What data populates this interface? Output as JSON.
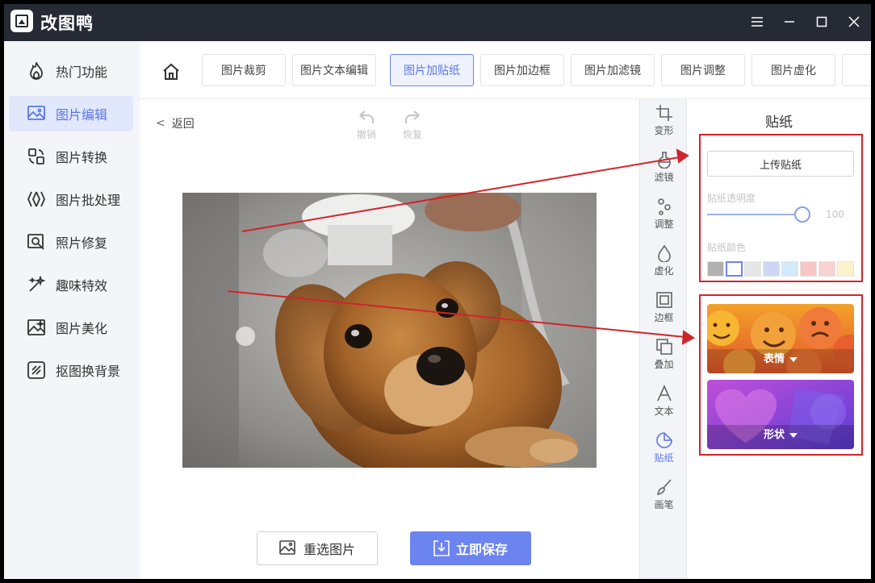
{
  "app": {
    "title": "改图鸭"
  },
  "sidebar": {
    "items": [
      {
        "label": "热门功能",
        "icon": "fire-icon"
      },
      {
        "label": "图片编辑",
        "icon": "image-edit-icon"
      },
      {
        "label": "图片转换",
        "icon": "convert-icon"
      },
      {
        "label": "图片批处理",
        "icon": "batch-icon"
      },
      {
        "label": "照片修复",
        "icon": "photo-repair-icon"
      },
      {
        "label": "趣味特效",
        "icon": "magic-wand-icon"
      },
      {
        "label": "图片美化",
        "icon": "beautify-icon"
      },
      {
        "label": "抠图换背景",
        "icon": "cutout-icon"
      }
    ],
    "active_index": 1
  },
  "tabs": {
    "items": [
      "图片裁剪",
      "图片文本编辑",
      "图片加贴纸",
      "图片加边框",
      "图片加滤镜",
      "图片调整",
      "图片虚化"
    ],
    "active_index": 2
  },
  "canvas": {
    "back_label": "返回",
    "undo_label": "撤销",
    "redo_label": "恢复",
    "reselect_label": "重选图片",
    "save_label": "立即保存"
  },
  "tools": {
    "items": [
      {
        "label": "变形",
        "icon": "transform-icon"
      },
      {
        "label": "滤镜",
        "icon": "filter-icon"
      },
      {
        "label": "调整",
        "icon": "adjust-icon"
      },
      {
        "label": "虚化",
        "icon": "blur-drop-icon"
      },
      {
        "label": "边框",
        "icon": "frame-icon"
      },
      {
        "label": "叠加",
        "icon": "overlay-icon"
      },
      {
        "label": "文本",
        "icon": "text-icon"
      },
      {
        "label": "贴纸",
        "icon": "sticker-icon"
      },
      {
        "label": "画笔",
        "icon": "brush-icon"
      }
    ],
    "active_index": 7
  },
  "panel": {
    "title": "贴纸",
    "upload_label": "上传贴纸",
    "opacity_label": "贴纸透明度",
    "opacity_value": "100",
    "opacity_fraction": 1.0,
    "color_label": "贴纸颜色",
    "swatches": [
      "#b0b0b0",
      "#ffffff",
      "#e6e6e6",
      "#cdd7f5",
      "#d2eafa",
      "#f7c7c5",
      "#f8d3d1",
      "#fdf2cc"
    ],
    "selected_swatch": 1,
    "categories": [
      {
        "label": "表情"
      },
      {
        "label": "形状"
      }
    ]
  },
  "colors": {
    "accent": "#5b77e8",
    "save_button": "#6c84ef",
    "highlight": "#d0242b",
    "titlebar": "#262a34"
  }
}
